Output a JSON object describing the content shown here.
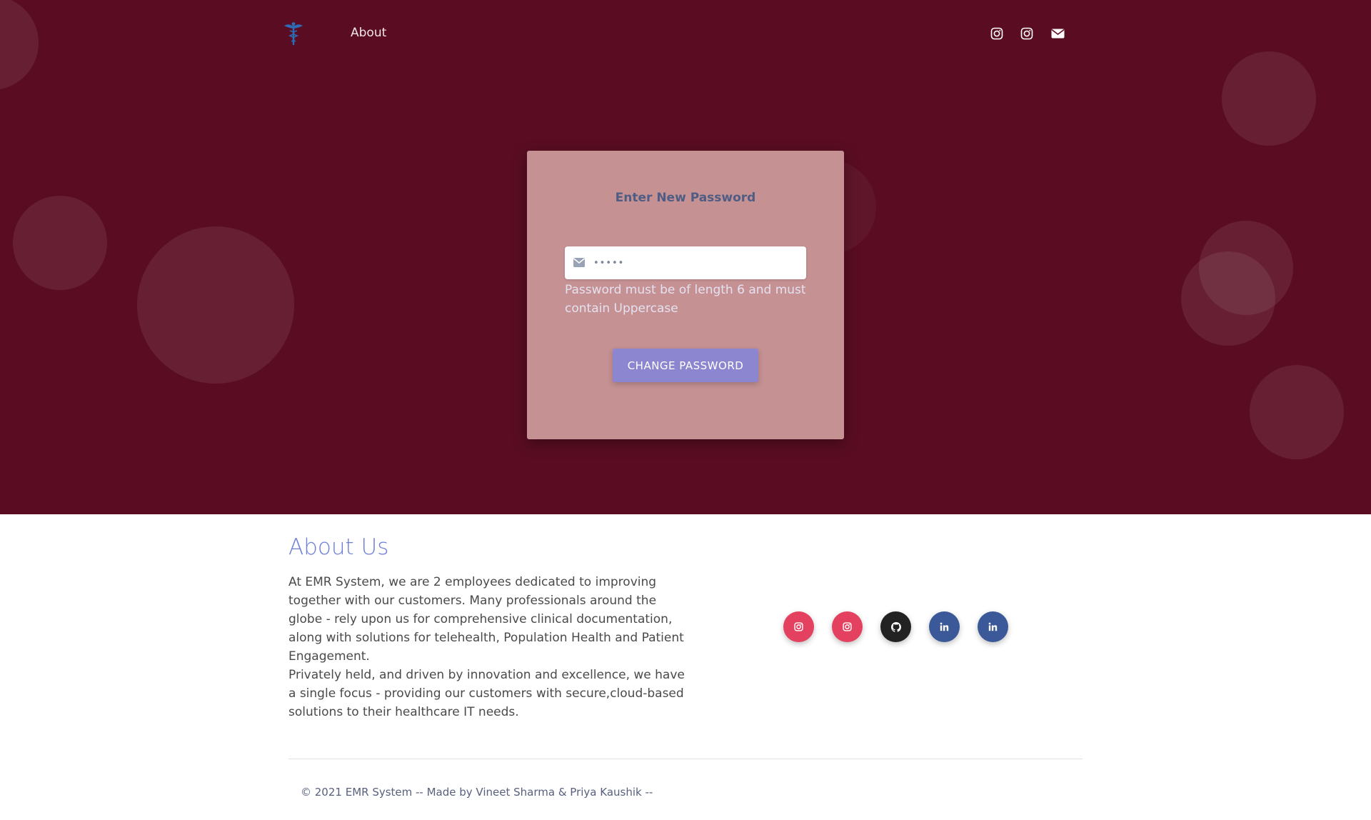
{
  "colors": {
    "hero_background": "#5a0d22",
    "card_background": "#c59193",
    "button_background": "#8c85cf",
    "title_accent": "#6c7fd8",
    "instagram": "#e4405f",
    "github": "#222222",
    "linkedin": "#3b5998"
  },
  "nav": {
    "logo_icon": "caduceus-icon",
    "about_label": "About",
    "icons": [
      "instagram-icon",
      "instagram-icon",
      "envelope-icon"
    ]
  },
  "reset_card": {
    "title": "Enter New Password",
    "password_value": "•••••",
    "field_icon": "envelope-icon",
    "hint": "Password must be of length 6 and must contain Uppercase",
    "button_label": "CHANGE PASSWORD"
  },
  "about": {
    "title": "About Us",
    "paragraph_1": "At EMR System, we are 2 employees dedicated to improving together with our customers. Many professionals around the globe - rely upon us for comprehensive clinical documentation, along with solutions for telehealth, Population Health and Patient Engagement.",
    "paragraph_2": "Privately held, and driven by innovation and excellence, we have a single focus - providing our customers with secure,cloud-based solutions to their healthcare IT needs.",
    "social_icons": [
      "instagram-icon",
      "instagram-icon",
      "github-icon",
      "linkedin-icon",
      "linkedin-icon"
    ]
  },
  "footer": {
    "text": "© 2021 EMR System -- Made by Vineet Sharma & Priya Kaushik --"
  }
}
